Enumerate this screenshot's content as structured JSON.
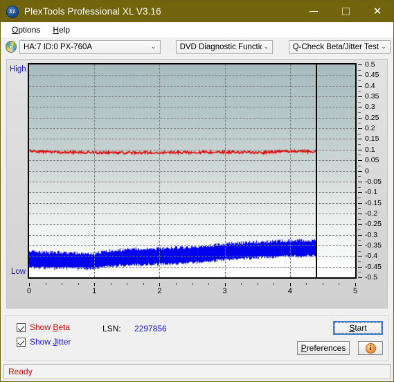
{
  "window": {
    "title": "PlexTools Professional XL V3.16",
    "icon": "xl-app-icon",
    "minimize_label": "–",
    "maximize_label": "□",
    "close_label": "✕"
  },
  "menu": {
    "items": [
      {
        "label": "Options",
        "accel": "O"
      },
      {
        "label": "Help",
        "accel": "H"
      }
    ]
  },
  "toolbar": {
    "disc_icon": "optical-disc-icon",
    "drive": {
      "value": "HA:7 ID:0  PX-760A",
      "arrow": "⌄"
    },
    "function": {
      "value": "DVD Diagnostic Functions",
      "arrow": "⌄"
    },
    "test": {
      "value": "Q-Check Beta/Jitter Test",
      "arrow": "⌄"
    }
  },
  "chart_axis": {
    "high_label": "High",
    "low_label": "Low",
    "y_ticks": [
      "0.5",
      "0.45",
      "0.4",
      "0.35",
      "0.3",
      "0.25",
      "0.2",
      "0.15",
      "0.1",
      "0.05",
      "0",
      "-0.05",
      "-0.1",
      "-0.15",
      "-0.2",
      "-0.25",
      "-0.3",
      "-0.35",
      "-0.4",
      "-0.45",
      "-0.5"
    ],
    "x_ticks": [
      "0",
      "1",
      "2",
      "3",
      "4",
      "5"
    ]
  },
  "controls": {
    "show_beta": {
      "label": "Show Beta",
      "accel": "B",
      "checked": true,
      "color": "#e00000"
    },
    "show_jitter": {
      "label": "Show Jitter",
      "accel": "J",
      "checked": true,
      "color": "#1414d2"
    },
    "lsn_label": "LSN:",
    "lsn_value": "2297856",
    "start_label": "Start",
    "start_accel": "S",
    "preferences_label": "Preferences",
    "preferences_accel": "P",
    "info_icon": "info-icon",
    "info_glyph": "i"
  },
  "status": {
    "text": "Ready"
  },
  "chart_data": {
    "type": "line",
    "title": "Q-Check Beta/Jitter Test",
    "xlabel": "",
    "ylabel": "",
    "xlim": [
      0,
      5
    ],
    "ylim": [
      -0.5,
      0.5
    ],
    "grid": true,
    "legend": "checkbox-toggles",
    "data_end_x": 4.4,
    "cursor_x": 4.4,
    "y_major_step": 0.05,
    "x_major_step": 1,
    "series": [
      {
        "name": "Beta",
        "color": "#e00000",
        "type": "line",
        "description": "Beta value, near-flat noisy trace",
        "x": [
          0,
          0.2,
          0.4,
          0.6,
          0.8,
          1.0,
          1.2,
          1.4,
          1.6,
          1.8,
          2.0,
          2.2,
          2.4,
          2.6,
          2.8,
          3.0,
          3.2,
          3.4,
          3.6,
          3.8,
          4.0,
          4.2,
          4.4
        ],
        "values": [
          0.093,
          0.09,
          0.089,
          0.088,
          0.087,
          0.087,
          0.086,
          0.086,
          0.085,
          0.086,
          0.086,
          0.087,
          0.087,
          0.088,
          0.088,
          0.089,
          0.088,
          0.087,
          0.086,
          0.09,
          0.093,
          0.092,
          0.091
        ],
        "noise_amplitude": 0.012
      },
      {
        "name": "Jitter",
        "color": "#0000ee",
        "type": "band",
        "description": "Jitter noise band, rises gradually across the disc",
        "x": [
          0,
          0.2,
          0.4,
          0.6,
          0.8,
          1.0,
          1.2,
          1.4,
          1.6,
          1.8,
          2.0,
          2.2,
          2.4,
          2.6,
          2.8,
          3.0,
          3.2,
          3.4,
          3.6,
          3.8,
          4.0,
          4.2,
          4.4
        ],
        "upper": [
          -0.383,
          -0.385,
          -0.386,
          -0.388,
          -0.389,
          -0.39,
          -0.378,
          -0.373,
          -0.37,
          -0.368,
          -0.366,
          -0.364,
          -0.362,
          -0.358,
          -0.352,
          -0.346,
          -0.341,
          -0.338,
          -0.335,
          -0.333,
          -0.331,
          -0.33,
          -0.329
        ],
        "lower": [
          -0.452,
          -0.454,
          -0.455,
          -0.456,
          -0.457,
          -0.458,
          -0.447,
          -0.442,
          -0.44,
          -0.438,
          -0.437,
          -0.435,
          -0.432,
          -0.428,
          -0.422,
          -0.416,
          -0.411,
          -0.408,
          -0.405,
          -0.402,
          -0.4,
          -0.399,
          -0.398
        ]
      }
    ]
  }
}
